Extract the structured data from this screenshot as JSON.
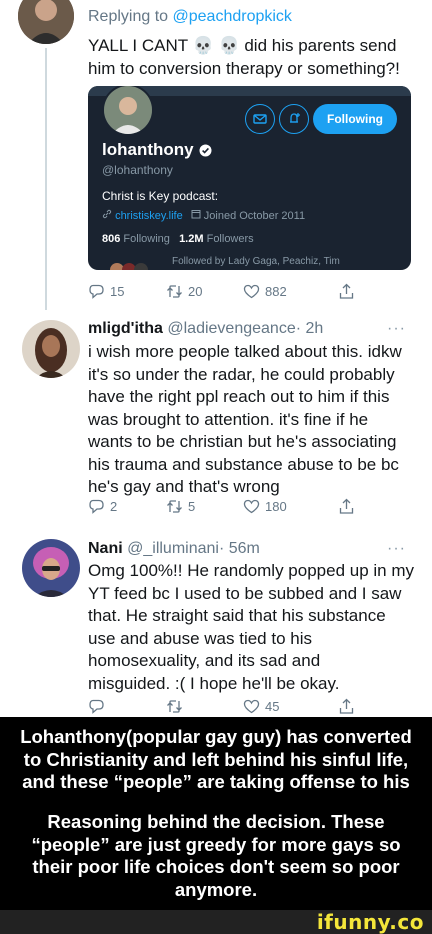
{
  "tweet1": {
    "reply_prefix": "Replying to",
    "reply_handle": "@peachdropkick",
    "text_line1": "YALL I CANT 💀 💀 did his parents send",
    "text_line2": "him to conversion therapy or something?!",
    "card": {
      "name": "lohanthony",
      "handle": "@lohanthony",
      "follow_label": "Following",
      "bio": "Christ is Key podcast:",
      "link": "christiskey.life",
      "joined": "Joined October 2011",
      "following_count": "806",
      "following_label": "Following",
      "followers_count": "1.2M",
      "followers_label": "Followers",
      "followed_by": "Followed by Lady Gaga, Peachiz, Tim"
    },
    "actions": {
      "replies": "15",
      "retweets": "20",
      "likes": "882"
    }
  },
  "tweet2": {
    "name": "mligd'itha",
    "handle": "@ladievengeance",
    "time": "· 2h",
    "more": "···",
    "lines": [
      "i wish more people talked about this. idkw",
      "it's so under the radar, he could probably",
      "have the right ppl reach out to him if this",
      "was brought to attention. it's fine if he",
      "wants to be christian but he's associating",
      "his trauma and substance abuse to be bc",
      "he's gay and that's wrong"
    ],
    "actions": {
      "replies": "2",
      "retweets": "5",
      "likes": "180"
    }
  },
  "tweet3": {
    "name": "Nani",
    "handle": "@_illuminani",
    "time": "· 56m",
    "more": "···",
    "lines": [
      "Omg 100%!! He randomly popped up in my",
      "YT feed bc I used to be subbed and I saw",
      "that. He straight said that his substance",
      "use and abuse was tied to his",
      "homosexuality, and its sad and",
      "misguided. :( I hope he'll be okay."
    ],
    "actions": {
      "replies": "",
      "retweets": "",
      "likes": "45"
    }
  },
  "caption": {
    "lines1": [
      "Lohanthony(popular gay guy) has converted",
      "to Christianity and left behind his sinful life,",
      "and these “people” are taking offense to his"
    ],
    "lines2": [
      "Reasoning behind the decision. These",
      "“people” are just greedy for more gays so",
      "their poor life choices don't seem so poor",
      "anymore."
    ]
  },
  "watermark": "ifunny.co",
  "colors": {
    "accent": "#1da1f2",
    "muted": "#657786",
    "card_bg": "#1a2330",
    "watermark": "#f4e63a"
  }
}
